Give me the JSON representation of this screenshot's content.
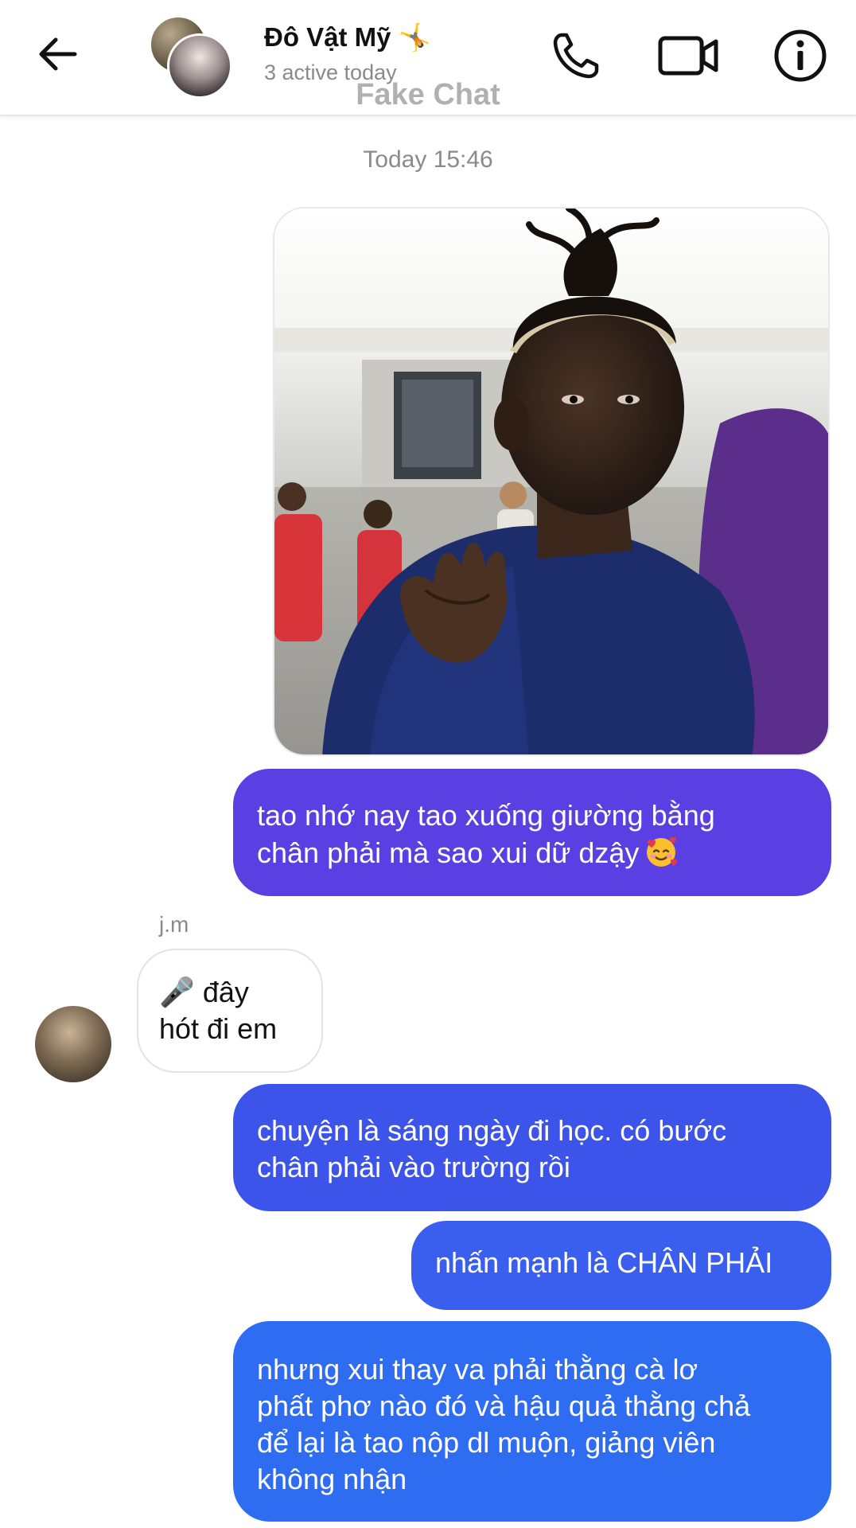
{
  "header": {
    "contact_name": "Đô Vật Mỹ 🤸",
    "active_status": "3 active today",
    "watermark": "Fake Chat"
  },
  "conversation": {
    "timestamp": "Today 15:46",
    "messages": [
      {
        "direction": "outgoing",
        "type": "image",
        "image_description": "girl-shrugging-meme-photo"
      },
      {
        "direction": "outgoing",
        "type": "text",
        "lines": [
          "tao nhớ nay tao xuống giường bằng",
          "chân phải mà sao xui dữ dzậy"
        ],
        "emoji": "smiling-face-with-hearts",
        "color": "#5a3fe2"
      },
      {
        "direction": "incoming",
        "type": "text",
        "sender": "j.m",
        "lines": [
          "🎤 đây",
          "hót đi em"
        ]
      },
      {
        "direction": "outgoing",
        "type": "text",
        "lines": [
          "chuyện là sáng ngày đi học. có bước",
          "chân phải vào trường rồi"
        ],
        "color": "#3c54ea"
      },
      {
        "direction": "outgoing",
        "type": "text",
        "lines": [
          "nhấn mạnh là CHÂN PHẢI"
        ],
        "color": "#3a5fee"
      },
      {
        "direction": "outgoing",
        "type": "text",
        "lines": [
          "nhưng xui thay va phải thằng cà lơ",
          "phất phơ nào đó và hậu quả thằng chả",
          "để lại là tao nộp dl muộn, giảng viên",
          "không nhận"
        ],
        "color": "#2e6cf2"
      }
    ]
  },
  "icons": {
    "back": "arrow-left-icon",
    "call": "phone-icon",
    "video": "video-camera-icon",
    "info": "info-icon"
  },
  "colors": {
    "gradient_top": "#5a3fe2",
    "gradient_bottom": "#2e6cf2",
    "incoming_bubble": "#ffffff",
    "secondary_text": "#8a8a8a"
  }
}
